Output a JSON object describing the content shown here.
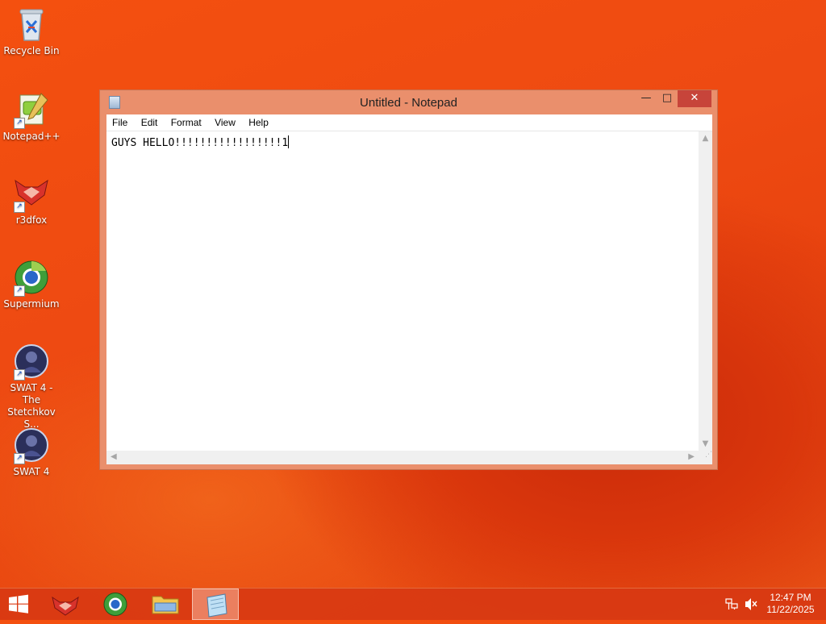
{
  "desktop": {
    "icons": [
      {
        "label": "Recycle Bin"
      },
      {
        "label": "Notepad++"
      },
      {
        "label": "r3dfox"
      },
      {
        "label": "Supermium"
      },
      {
        "label": "SWAT 4 - The\nStetchkov S..."
      },
      {
        "label": "SWAT 4"
      }
    ],
    "shortcut_glyph": "↗"
  },
  "window": {
    "title": "Untitled - Notepad",
    "minimize_glyph": "—",
    "maximize_glyph": "□",
    "close_glyph": "✕",
    "menu": [
      "File",
      "Edit",
      "Format",
      "View",
      "Help"
    ],
    "content": "GUYS HELLO!!!!!!!!!!!!!!!!!1",
    "scroll_up": "▲",
    "scroll_down": "▼",
    "scroll_left": "◀",
    "scroll_right": "▶",
    "grip": "⋰"
  },
  "taskbar": {
    "start_icon": "windows-start-icon",
    "pinned": [
      "r3dfox",
      "Supermium",
      "File Explorer",
      "Notepad"
    ],
    "clock_time": "12:47 PM",
    "clock_date": "11/22/2025"
  },
  "colors": {
    "accent": "#ea8f6c",
    "close": "#c7443a",
    "taskbar": "#d73812"
  }
}
